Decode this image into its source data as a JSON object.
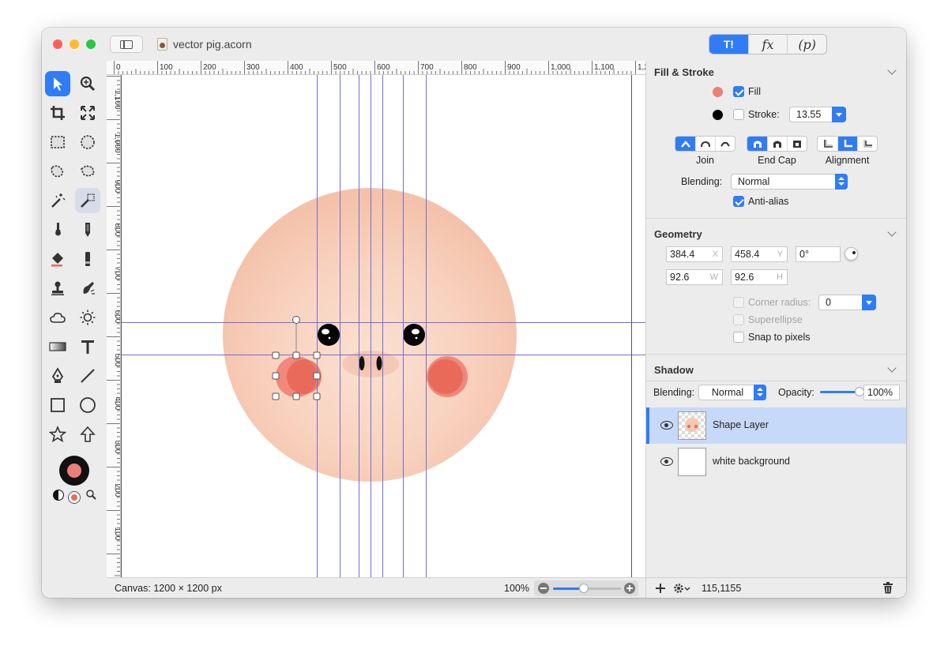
{
  "window": {
    "title": "vector pig.acorn"
  },
  "traffic_lights": {
    "close_color": "#fe5f57",
    "minimize_color": "#febc2e",
    "zoom_color": "#28c840"
  },
  "inspector_tabs": [
    {
      "icon": "hammer-icon",
      "label": "T!"
    },
    {
      "label": "fx"
    },
    {
      "label": "(p)"
    }
  ],
  "ruler": {
    "top_labels": [
      "0",
      "100",
      "200",
      "300",
      "400",
      "500",
      "600",
      "700",
      "800",
      "900",
      "1,000",
      "1,100",
      "1,2"
    ],
    "left_labels": [
      "1,100",
      "1,000",
      "900",
      "800",
      "700",
      "600",
      "500",
      "400",
      "300",
      "200",
      "100"
    ]
  },
  "status": {
    "canvas_size": "Canvas: 1200 × 1200 px",
    "zoom": "100%",
    "zoom_level": 0.45
  },
  "colors": {
    "accent": "#2f7cf6",
    "pig_skin": "#f6c8b2",
    "cheek": "#e86a5a",
    "guide": "#6f6fd6",
    "fill_swatch": "#ec7f7a",
    "stroke_swatch": "#000000"
  },
  "fill_stroke": {
    "title": "Fill & Stroke",
    "fill_label": "Fill",
    "fill_checked": true,
    "stroke_label": "Stroke:",
    "stroke_checked": false,
    "stroke_width": "13.55",
    "join_label": "Join",
    "endcap_label": "End Cap",
    "alignment_label": "Alignment",
    "blending_label": "Blending:",
    "blending_value": "Normal",
    "antialias_label": "Anti-alias",
    "antialias_checked": true
  },
  "geometry": {
    "title": "Geometry",
    "x": "384.4",
    "x_unit": "X",
    "y": "458.4",
    "y_unit": "Y",
    "rotation": "0°",
    "w": "92.6",
    "w_unit": "W",
    "h": "92.6",
    "h_unit": "H",
    "corner_radius_label": "Corner radius:",
    "corner_radius_value": "0",
    "superellipse_label": "Superellipse",
    "snap_label": "Snap to pixels"
  },
  "shadow": {
    "title": "Shadow",
    "blending_label": "Blending:",
    "blending_value": "Normal",
    "opacity_label": "Opacity:",
    "opacity_value": "100%",
    "opacity_level": 1.0
  },
  "layers": [
    {
      "name": "Shape Layer",
      "selected": true,
      "visible": true
    },
    {
      "name": "white background",
      "selected": false,
      "visible": true
    }
  ],
  "inspector_status": {
    "coords": "115,1155"
  },
  "tools": [
    {
      "name": "arrow-tool-icon"
    },
    {
      "name": "zoom-tool-icon"
    },
    {
      "name": "crop-tool-icon"
    },
    {
      "name": "transform-tool-icon"
    },
    {
      "name": "rect-select-icon"
    },
    {
      "name": "ellipse-select-icon"
    },
    {
      "name": "lasso-icon"
    },
    {
      "name": "polygon-lasso-icon"
    },
    {
      "name": "magic-wand-icon"
    },
    {
      "name": "instant-alpha-icon"
    },
    {
      "name": "brush-icon"
    },
    {
      "name": "pencil-icon"
    },
    {
      "name": "paint-bucket-icon"
    },
    {
      "name": "eraser-icon"
    },
    {
      "name": "clone-stamp-icon"
    },
    {
      "name": "smudge-icon"
    },
    {
      "name": "cloud-icon"
    },
    {
      "name": "sun-icon"
    },
    {
      "name": "gradient-icon"
    },
    {
      "name": "text-tool-icon"
    },
    {
      "name": "pen-tool-icon"
    },
    {
      "name": "line-tool-icon"
    },
    {
      "name": "rectangle-shape-icon"
    },
    {
      "name": "oval-shape-icon"
    },
    {
      "name": "star-shape-icon"
    },
    {
      "name": "arrow-shape-icon"
    }
  ]
}
